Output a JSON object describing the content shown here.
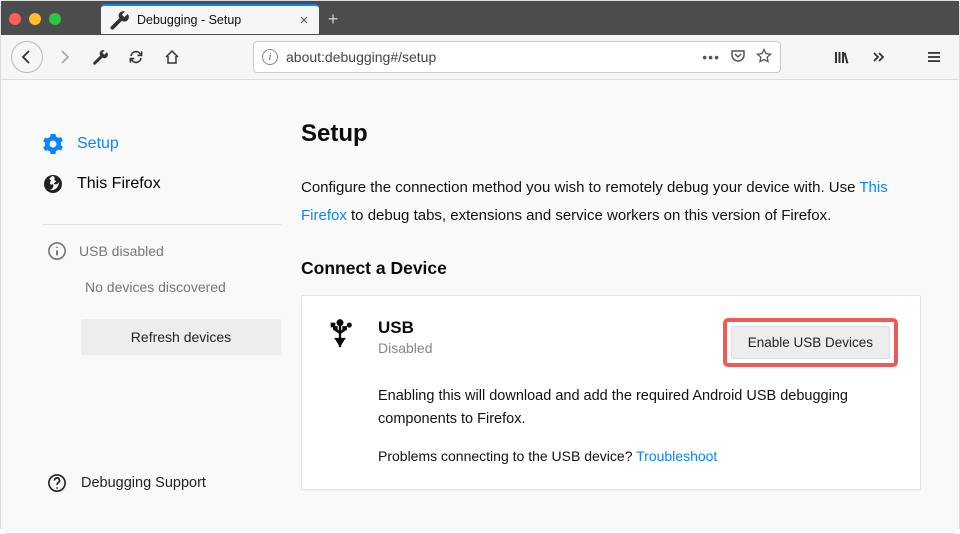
{
  "window": {
    "traffic_colors": [
      "#ff5f57",
      "#febc2e",
      "#28c840"
    ]
  },
  "tab": {
    "title": "Debugging - Setup"
  },
  "url": "about:debugging#/setup",
  "sidebar": {
    "setup_label": "Setup",
    "this_firefox_label": "This Firefox",
    "usb_status": "USB disabled",
    "no_devices": "No devices discovered",
    "refresh_label": "Refresh devices",
    "support_label": "Debugging Support"
  },
  "main": {
    "heading": "Setup",
    "desc_pre": "Configure the connection method you wish to remotely debug your device with. Use ",
    "desc_link": "This Firefox",
    "desc_post": " to debug tabs, extensions and service workers on this version of Firefox.",
    "connect_heading": "Connect a Device",
    "usb": {
      "title": "USB",
      "status": "Disabled",
      "enable_label": "Enable USB Devices",
      "body": "Enabling this will download and add the required Android USB debugging components to Firefox.",
      "trouble_pre": "Problems connecting to the USB device? ",
      "trouble_link": "Troubleshoot"
    }
  }
}
